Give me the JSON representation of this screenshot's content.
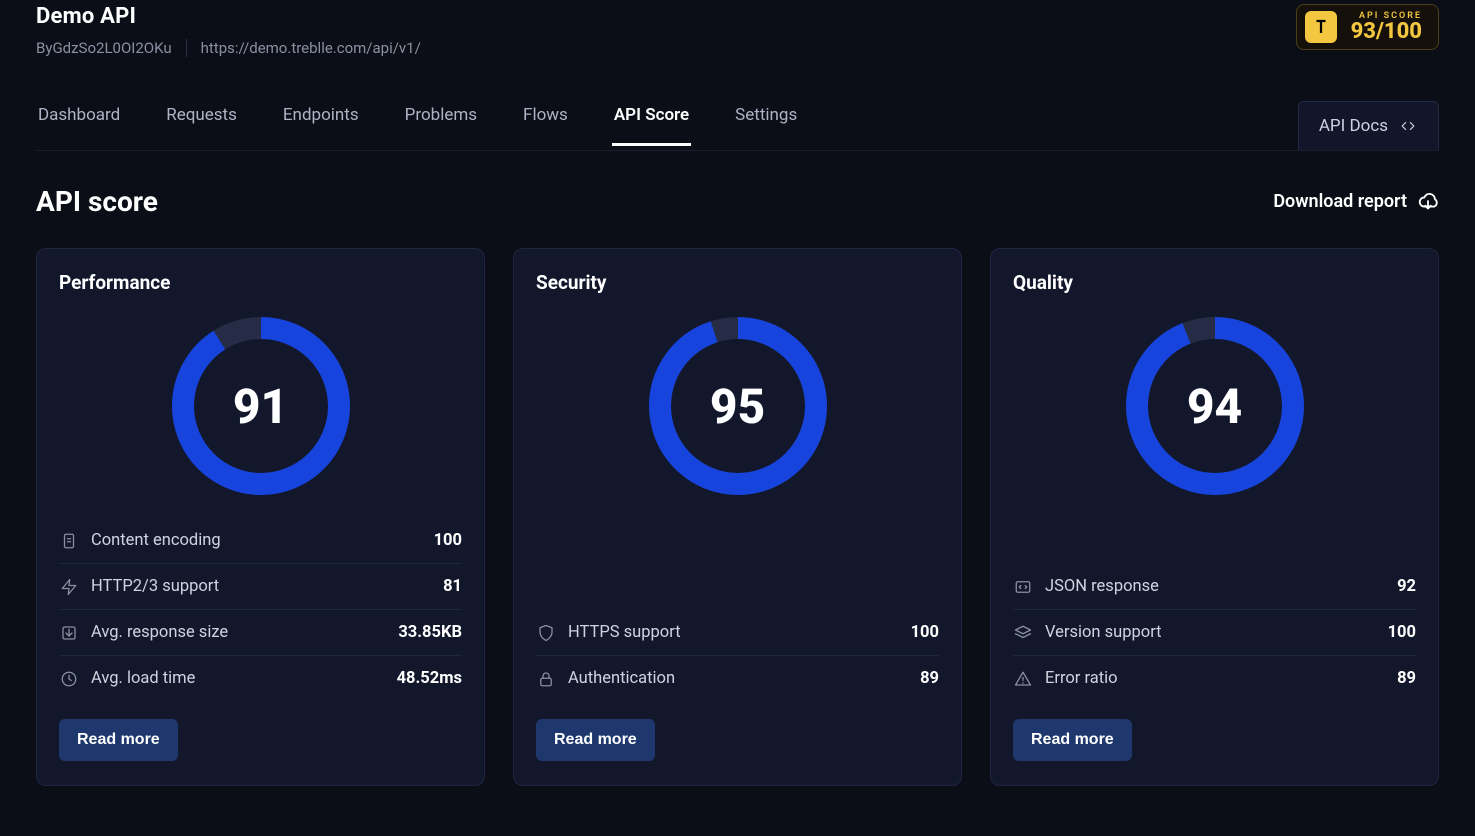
{
  "header": {
    "api_title": "Demo API",
    "api_id": "ByGdzSo2L0OI2OKu",
    "api_url": "https://demo.treblle.com/api/v1/",
    "score_label": "API SCORE",
    "score_value": "93/100"
  },
  "nav": {
    "tabs": [
      {
        "label": "Dashboard",
        "active": false
      },
      {
        "label": "Requests",
        "active": false
      },
      {
        "label": "Endpoints",
        "active": false
      },
      {
        "label": "Problems",
        "active": false
      },
      {
        "label": "Flows",
        "active": false
      },
      {
        "label": "API Score",
        "active": true
      },
      {
        "label": "Settings",
        "active": false
      }
    ],
    "api_docs_label": "API Docs"
  },
  "section": {
    "title": "API score",
    "download_label": "Download report"
  },
  "cards": [
    {
      "title": "Performance",
      "score": 91,
      "metrics": [
        {
          "icon": "file-icon",
          "label": "Content encoding",
          "value": "100"
        },
        {
          "icon": "bolt-icon",
          "label": "HTTP2/3 support",
          "value": "81"
        },
        {
          "icon": "download-icon",
          "label": "Avg. response size",
          "value": "33.85KB"
        },
        {
          "icon": "clock-icon",
          "label": "Avg. load time",
          "value": "48.52ms"
        }
      ],
      "read_more": "Read more"
    },
    {
      "title": "Security",
      "score": 95,
      "metrics": [
        {
          "icon": "shield-icon",
          "label": "HTTPS support",
          "value": "100"
        },
        {
          "icon": "lock-icon",
          "label": "Authentication",
          "value": "89"
        }
      ],
      "read_more": "Read more"
    },
    {
      "title": "Quality",
      "score": 94,
      "metrics": [
        {
          "icon": "code-icon",
          "label": "JSON response",
          "value": "92"
        },
        {
          "icon": "layers-icon",
          "label": "Version support",
          "value": "100"
        },
        {
          "icon": "alert-icon",
          "label": "Error ratio",
          "value": "89"
        }
      ],
      "read_more": "Read more"
    }
  ],
  "chart_data": [
    {
      "type": "gauge",
      "title": "Performance",
      "value": 91,
      "max": 100
    },
    {
      "type": "gauge",
      "title": "Security",
      "value": 95,
      "max": 100
    },
    {
      "type": "gauge",
      "title": "Quality",
      "value": 94,
      "max": 100
    }
  ],
  "colors": {
    "accent": "#1644dd",
    "badge_gold": "#f3c73f",
    "panel_bg": "#12172c",
    "track": "#262c46"
  }
}
